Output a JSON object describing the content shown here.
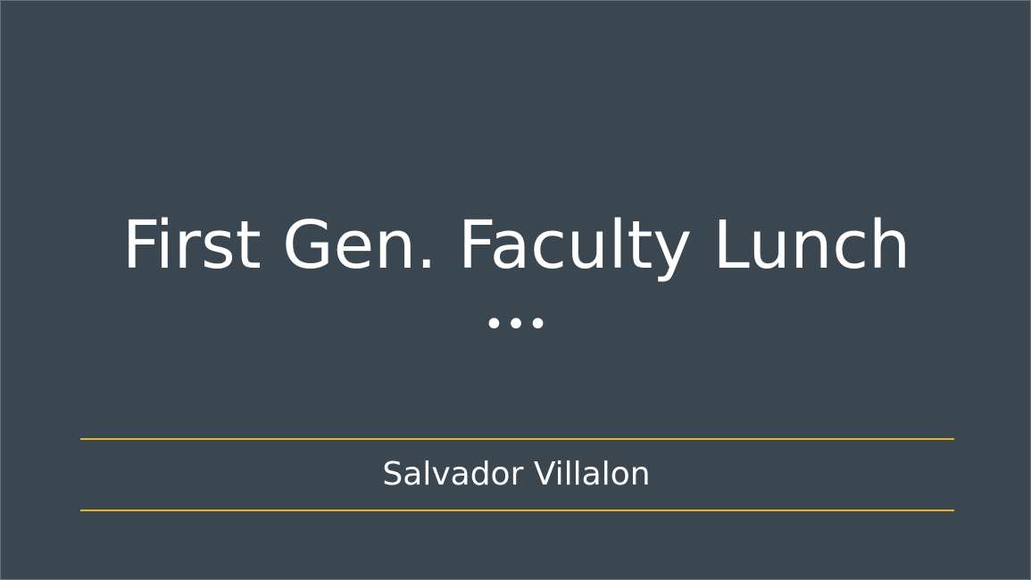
{
  "slide": {
    "title": "First Gen. Faculty Lunch",
    "ellipsis": "•••",
    "subtitle": "Salvador Villalon"
  },
  "colors": {
    "background": "#3a4750",
    "accent_rule": "#e8b52a",
    "text": "#ffffff"
  }
}
